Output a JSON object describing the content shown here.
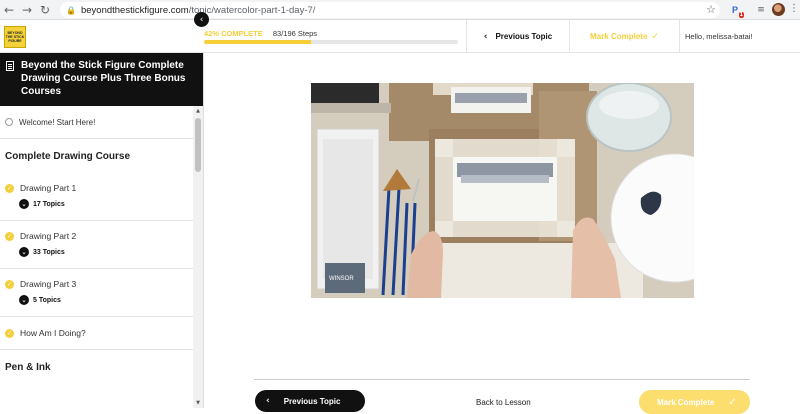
{
  "browser": {
    "url_domain": "beyondthestickfigure.com",
    "url_path": "/topic/watercolor-part-1-day-7/",
    "extension_badge": "1"
  },
  "logo": {
    "lines": [
      "BEYOND",
      "THE STICK",
      "FIGURE"
    ]
  },
  "progress": {
    "percent_label": "42% COMPLETE",
    "steps_label": "83/196 Steps",
    "fraction": 0.42
  },
  "header": {
    "previous_topic": "Previous Topic",
    "mark_complete": "Mark Complete",
    "greeting": "Hello, melissa-batai!"
  },
  "sidebar": {
    "course_title": "Beyond the Stick Figure Complete Drawing Course Plus Three Bonus Courses",
    "welcome": "Welcome! Start Here!",
    "section1": "Complete Drawing Course",
    "lessons": [
      {
        "title": "Drawing Part 1",
        "topics": "17 Topics"
      },
      {
        "title": "Drawing Part 2",
        "topics": "33 Topics"
      },
      {
        "title": "Drawing Part 3",
        "topics": "5 Topics"
      }
    ],
    "how_am_i": "How Am I Doing?",
    "section2": "Pen & Ink"
  },
  "video": {
    "tube_brand": "WINSOR"
  },
  "footer": {
    "previous_topic": "Previous Topic",
    "back_to_lesson": "Back to Lesson",
    "mark_complete": "Mark Complete"
  },
  "colors": {
    "accent_yellow": "#f5cf3a",
    "sidebar_header": "#111111"
  }
}
